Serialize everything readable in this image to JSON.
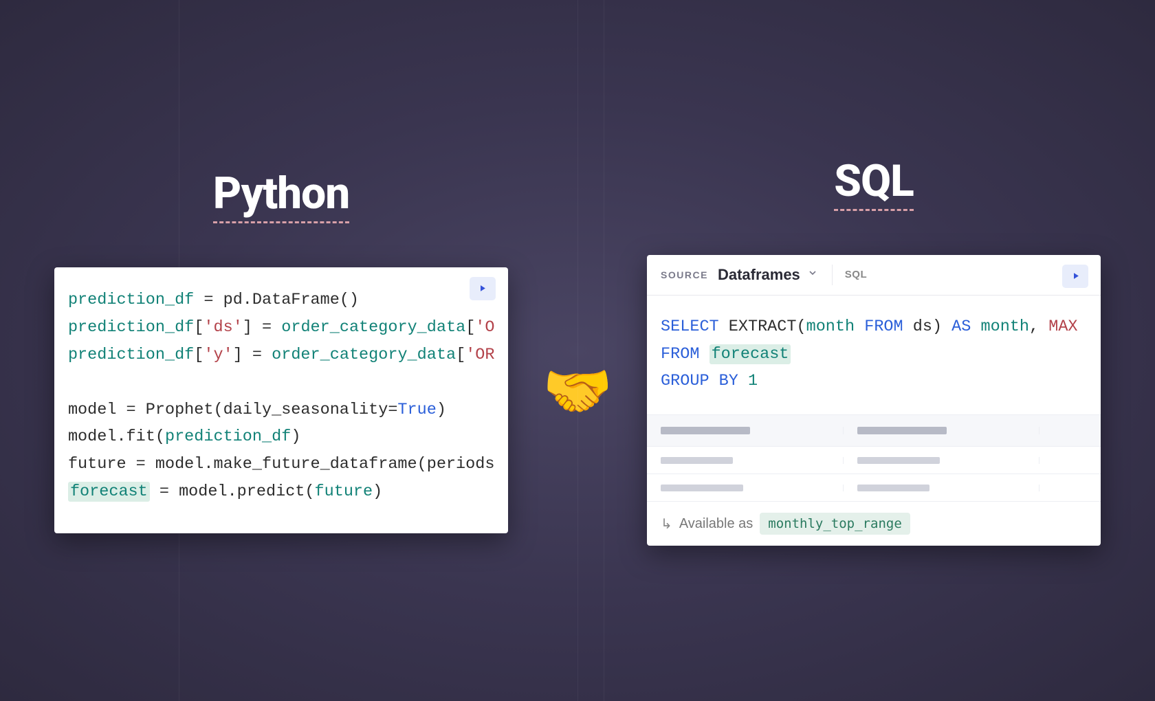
{
  "left": {
    "title": "Python",
    "code_lines": [
      "prediction_df = pd.DataFrame()",
      "prediction_df['ds'] = order_category_data['O",
      "prediction_df['y'] = order_category_data['OR",
      "",
      "model = Prophet(daily_seasonality=True)",
      "model.fit(prediction_df)",
      "future = model.make_future_dataframe(periods",
      "forecast = model.predict(future)"
    ]
  },
  "center": {
    "emoji": "🤝"
  },
  "right": {
    "title": "SQL",
    "header": {
      "source_label": "SOURCE",
      "source_value": "Dataframes",
      "lang": "SQL"
    },
    "sql": "SELECT EXTRACT(month FROM ds) AS month, MAX\nFROM forecast\nGROUP BY 1",
    "footer": {
      "text": "Available as",
      "badge": "monthly_top_range"
    }
  }
}
